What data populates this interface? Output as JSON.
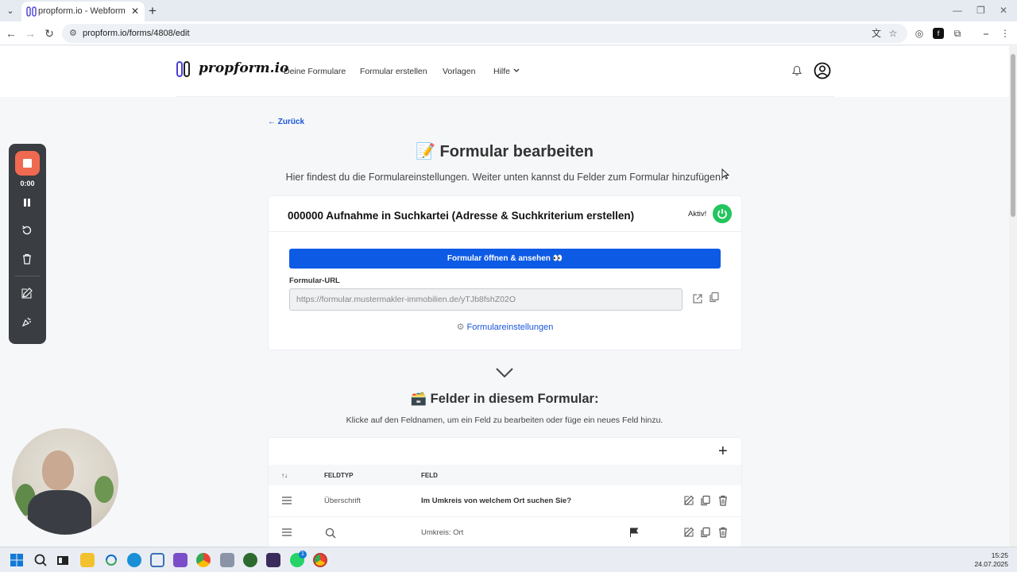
{
  "browser": {
    "tab_title": "propform.io - Webformular-Ba",
    "url": "propform.io/forms/4808/edit"
  },
  "nav": {
    "logo_text": "propform.io",
    "items": [
      "Deine Formulare",
      "Formular erstellen",
      "Vorlagen",
      "Hilfe"
    ]
  },
  "page": {
    "back_label": "Zurück",
    "title": "📝 Formular bearbeiten",
    "subtitle": "Hier findest du die Formulareinstellungen. Weiter unten kannst du Felder zum Formular hinzufügen."
  },
  "form_card": {
    "title": "000000 Aufnahme in Suchkartei (Adresse & Suchkriterium erstellen)",
    "status_label": "Aktiv!",
    "open_button": "Formular öffnen & ansehen 👀",
    "url_label": "Formular-URL",
    "url_value": "https://formular.mustermakler-immobilien.de/yTJb8fshZ02O",
    "settings_link": "Formulareinstellungen"
  },
  "fields_section": {
    "title": "🗃️ Felder in diesem Formular:",
    "subtitle": "Klicke auf den Feldnamen, um ein Feld zu bearbeiten oder füge ein neues Feld hinzu.",
    "columns": [
      "↑↓",
      "FELDTYP",
      "FELD"
    ],
    "rows": [
      {
        "type": "Überschrift",
        "field": "Im Umkreis von welchem Ort suchen Sie?"
      },
      {
        "type": "",
        "field": "Umkreis: Ort"
      }
    ]
  },
  "recorder": {
    "time": "0:00"
  },
  "taskbar": {
    "time": "15:25",
    "date": "24.07.2025",
    "badge": "1"
  },
  "colors": {
    "primary": "#0d5ae5",
    "active_green": "#22c55e",
    "record": "#ef6a50"
  }
}
